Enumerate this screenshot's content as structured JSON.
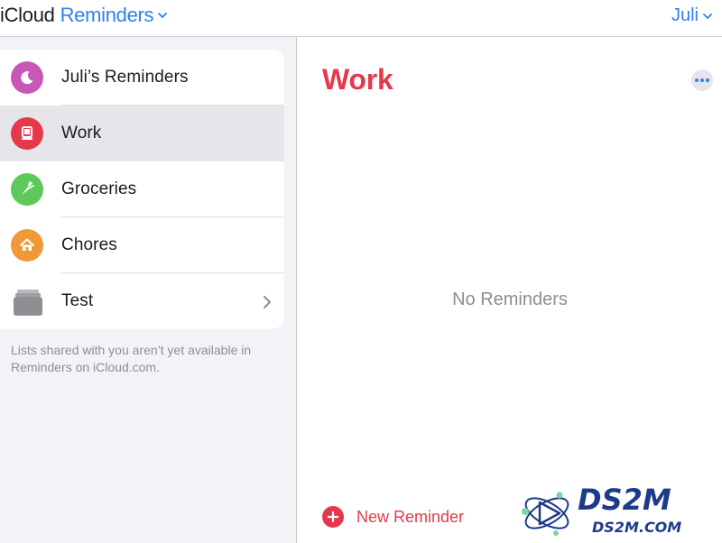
{
  "header": {
    "brand_prefix": "iCloud",
    "app_name": "Reminders",
    "user_name": "Juli"
  },
  "sidebar": {
    "lists": [
      {
        "label": "Juli’s Reminders",
        "icon": "moon-icon",
        "color": "#c957b8"
      },
      {
        "label": "Work",
        "icon": "laptop-icon",
        "color": "#e5394b"
      },
      {
        "label": "Groceries",
        "icon": "carrot-icon",
        "color": "#5cc95a"
      },
      {
        "label": "Chores",
        "icon": "house-icon",
        "color": "#f09a37"
      }
    ],
    "group": {
      "label": "Test",
      "icon": "stack-icon",
      "color": "#8e8e93"
    },
    "shared_note": "Lists shared with you aren’t yet available in Reminders on iCloud.com."
  },
  "main": {
    "title": "Work",
    "empty_text": "No Reminders",
    "new_reminder_label": "New Reminder",
    "accent": "#e5394b"
  },
  "watermark": {
    "logo_text": "DS2M",
    "url_text": "DS2M.COM"
  },
  "colors": {
    "link_blue": "#2f80ed",
    "sidebar_bg": "#f2f2f7",
    "selected_bg": "#e5e5ea"
  }
}
